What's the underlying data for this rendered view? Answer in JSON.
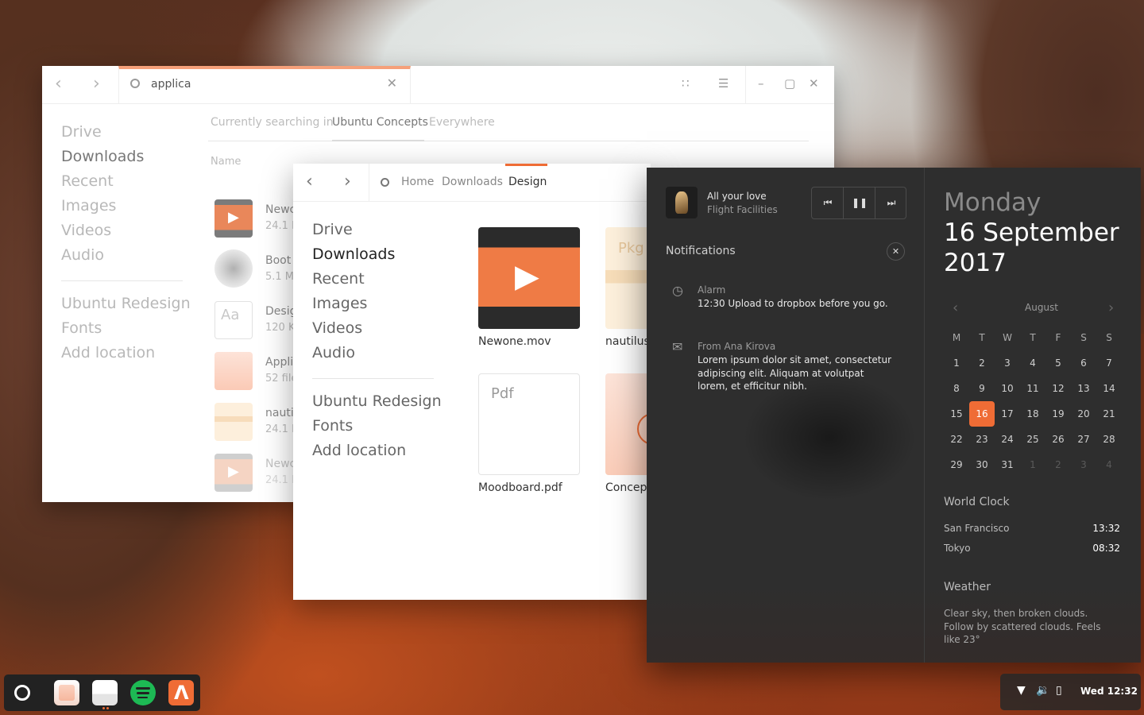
{
  "window_search": {
    "search_value": "applica",
    "scope_label": "Currently searching in",
    "scope_selected": "Ubuntu Concepts",
    "scope_other": "Everywhere",
    "column_name": "Name",
    "sidebar": [
      "Drive",
      "Downloads",
      "Recent",
      "Images",
      "Videos",
      "Audio"
    ],
    "sidebar_places": [
      "Ubuntu Redesign",
      "Fonts",
      "Add location"
    ],
    "results": [
      {
        "name": "Newc",
        "meta": "24.1 M"
      },
      {
        "name": "Boot",
        "meta": "5.1 M"
      },
      {
        "name": "Desig",
        "meta": "120 K"
      },
      {
        "name": "Applic",
        "meta": "52 file"
      },
      {
        "name": "nautil",
        "meta": "24.1 M"
      },
      {
        "name": "Newc",
        "meta": "24.1 M"
      }
    ],
    "font_thumb_text": "Aa"
  },
  "window_files": {
    "breadcrumbs": [
      "Home",
      "Downloads",
      "Design"
    ],
    "sidebar": [
      "Drive",
      "Downloads",
      "Recent",
      "Images",
      "Videos",
      "Audio"
    ],
    "sidebar_places": [
      "Ubuntu Redesign",
      "Fonts",
      "Add location"
    ],
    "files": [
      {
        "name": "Newone.mov"
      },
      {
        "name": "nautilus",
        "badge": "Pkg"
      },
      {
        "name": "Moodboard.pdf",
        "badge": "Pdf"
      },
      {
        "name": "Concep"
      }
    ]
  },
  "panel": {
    "song": "All your love",
    "artist": "Flight Facilities",
    "notifications_title": "Notifications",
    "notifications": [
      {
        "icon": "clock-icon",
        "title": "Alarm",
        "body": "12:30 Upload to dropbox before you go."
      },
      {
        "icon": "mail-icon",
        "title": "From Ana Kirova",
        "body": "Lorem ipsum dolor sit amet, consectetur adipiscing elit. Aliquam at volutpat lorem, et efficitur nibh."
      }
    ],
    "day": "Monday",
    "date": "16 September 2017",
    "calendar": {
      "month": "August",
      "weekdays": [
        "M",
        "T",
        "W",
        "T",
        "F",
        "S",
        "S"
      ],
      "weeks": [
        [
          "1",
          "2",
          "3",
          "4",
          "5",
          "6",
          "7"
        ],
        [
          "8",
          "9",
          "10",
          "11",
          "12",
          "13",
          "14"
        ],
        [
          "15",
          "16",
          "17",
          "18",
          "19",
          "20",
          "21"
        ],
        [
          "22",
          "23",
          "24",
          "25",
          "26",
          "27",
          "28"
        ],
        [
          "29",
          "30",
          "31",
          "1",
          "2",
          "3",
          "4"
        ]
      ],
      "today": "16"
    },
    "world_clock_title": "World Clock",
    "clocks": [
      {
        "city": "San Francisco",
        "time": "13:32"
      },
      {
        "city": "Tokyo",
        "time": "08:32"
      }
    ],
    "weather_title": "Weather",
    "weather_text": "Clear sky, then broken clouds. Follow by scattered clouds. Feels like 23°"
  },
  "tray": {
    "clock": "Wed 12:32"
  },
  "colors": {
    "accent": "#ef6c35",
    "panel_bg": "#2e2e2e"
  }
}
